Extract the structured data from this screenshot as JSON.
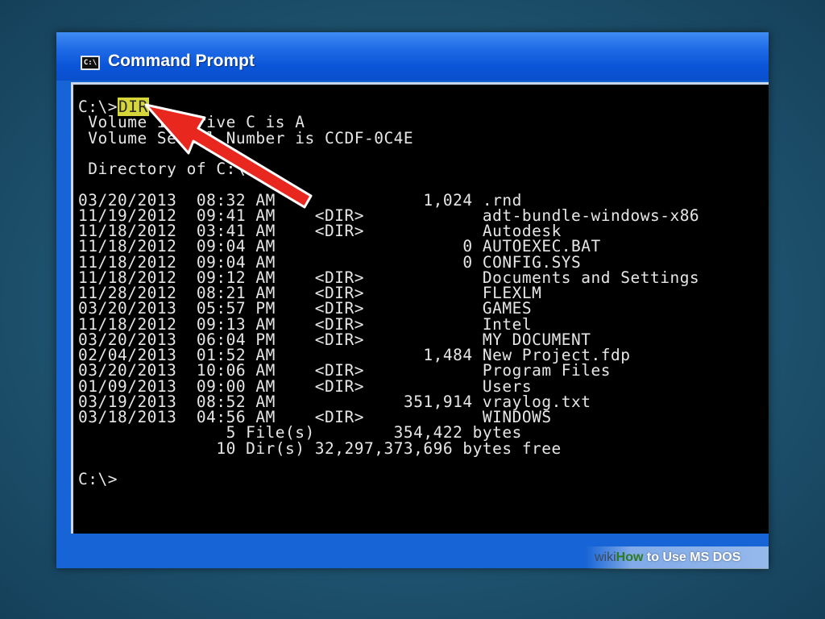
{
  "window": {
    "title": "Command Prompt",
    "icon_label": "C:\\"
  },
  "console": {
    "prompt": "C:\\>",
    "command": "DIR",
    "volume_line": " Volume in drive C is A",
    "serial_line": " Volume Serial Number is CCDF-0C4E",
    "directory_line": " Directory of C:\\",
    "entries": [
      {
        "date": "03/20/2013",
        "time": "08:32",
        "ampm": "AM",
        "dir": "",
        "size": "1,024",
        "name": ".rnd"
      },
      {
        "date": "11/19/2012",
        "time": "09:41",
        "ampm": "AM",
        "dir": "<DIR>",
        "size": "",
        "name": "adt-bundle-windows-x86"
      },
      {
        "date": "11/18/2012",
        "time": "03:41",
        "ampm": "AM",
        "dir": "<DIR>",
        "size": "",
        "name": "Autodesk"
      },
      {
        "date": "11/18/2012",
        "time": "09:04",
        "ampm": "AM",
        "dir": "",
        "size": "0",
        "name": "AUTOEXEC.BAT"
      },
      {
        "date": "11/18/2012",
        "time": "09:04",
        "ampm": "AM",
        "dir": "",
        "size": "0",
        "name": "CONFIG.SYS"
      },
      {
        "date": "11/18/2012",
        "time": "09:12",
        "ampm": "AM",
        "dir": "<DIR>",
        "size": "",
        "name": "Documents and Settings"
      },
      {
        "date": "11/28/2012",
        "time": "08:21",
        "ampm": "AM",
        "dir": "<DIR>",
        "size": "",
        "name": "FLEXLM"
      },
      {
        "date": "03/20/2013",
        "time": "05:57",
        "ampm": "PM",
        "dir": "<DIR>",
        "size": "",
        "name": "GAMES"
      },
      {
        "date": "11/18/2012",
        "time": "09:13",
        "ampm": "AM",
        "dir": "<DIR>",
        "size": "",
        "name": "Intel"
      },
      {
        "date": "03/20/2013",
        "time": "06:04",
        "ampm": "PM",
        "dir": "<DIR>",
        "size": "",
        "name": "MY DOCUMENT"
      },
      {
        "date": "02/04/2013",
        "time": "01:52",
        "ampm": "AM",
        "dir": "",
        "size": "1,484",
        "name": "New Project.fdp"
      },
      {
        "date": "03/20/2013",
        "time": "10:06",
        "ampm": "AM",
        "dir": "<DIR>",
        "size": "",
        "name": "Program Files"
      },
      {
        "date": "01/09/2013",
        "time": "09:00",
        "ampm": "AM",
        "dir": "<DIR>",
        "size": "",
        "name": "Users"
      },
      {
        "date": "03/19/2013",
        "time": "08:52",
        "ampm": "AM",
        "dir": "",
        "size": "351,914",
        "name": "vraylog.txt"
      },
      {
        "date": "03/18/2013",
        "time": "04:56",
        "ampm": "AM",
        "dir": "<DIR>",
        "size": "",
        "name": "WINDOWS"
      }
    ],
    "summary_files": {
      "count": "5",
      "label": "File(s)",
      "value": "354,422",
      "unit": "bytes"
    },
    "summary_dirs": {
      "count": "10",
      "label": "Dir(s)",
      "value": "32,297,373,696",
      "unit": "bytes free"
    },
    "final_prompt": "C:\\>"
  },
  "watermark": {
    "wiki": "wiki",
    "how": "How",
    "rest": " to Use MS DOS"
  },
  "colors": {
    "highlight": "#d6d63a",
    "arrow": "#e8281e",
    "titlebar": "#1764d6"
  }
}
